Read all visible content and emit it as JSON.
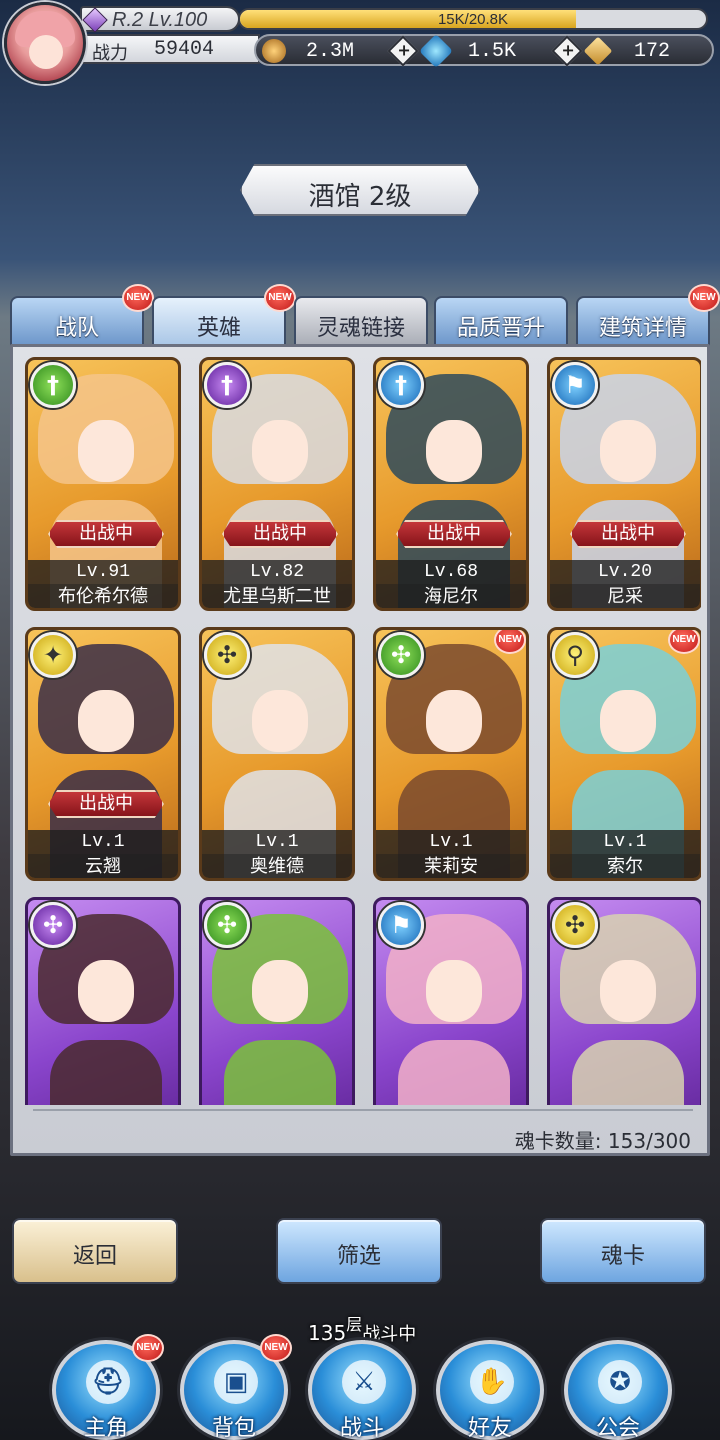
{
  "player": {
    "rank": "R.2 Lv.100",
    "exp_text": "15K/20.8K",
    "exp_fraction": 0.72,
    "power_label": "战力",
    "power_value": "59404"
  },
  "currency": [
    {
      "name": "gold",
      "value": "2.3M",
      "color": "#d9a03a"
    },
    {
      "name": "gem",
      "value": "1.5K",
      "color": "#3aa8e0"
    },
    {
      "name": "crystal",
      "value": "172",
      "color": "#e0b060"
    }
  ],
  "banner": {
    "title": "酒馆 2级"
  },
  "tabs": [
    {
      "label": "战队",
      "badge": "NEW"
    },
    {
      "label": "英雄",
      "badge": "NEW"
    },
    {
      "label": "灵魂链接",
      "badge": ""
    },
    {
      "label": "品质晋升",
      "badge": ""
    },
    {
      "label": "建筑详情",
      "badge": "NEW"
    }
  ],
  "heroes": [
    {
      "name": "布伦希尔德",
      "level": "Lv.91",
      "status": "出战中",
      "element": "green",
      "frame": "gold",
      "badge": "",
      "icon": "sword-icon",
      "hair": "#f5c48a"
    },
    {
      "name": "尤里乌斯二世",
      "level": "Lv.82",
      "status": "出战中",
      "element": "purple",
      "frame": "gold",
      "badge": "",
      "icon": "sword-icon",
      "hair": "#d8dbe2"
    },
    {
      "name": "海尼尔",
      "level": "Lv.68",
      "status": "出战中",
      "element": "blue",
      "frame": "gold",
      "badge": "",
      "icon": "sword-icon",
      "hair": "#2e4a5c"
    },
    {
      "name": "尼采",
      "level": "Lv.20",
      "status": "出战中",
      "element": "blue",
      "frame": "gold",
      "badge": "",
      "icon": "flag-icon",
      "hair": "#c8d4ea"
    },
    {
      "name": "云翘",
      "level": "Lv.1",
      "status": "出战中",
      "element": "yellow",
      "frame": "gold",
      "badge": "",
      "icon": "wings-icon",
      "hair": "#3a2e48"
    },
    {
      "name": "奥维德",
      "level": "Lv.1",
      "status": "",
      "element": "yellow",
      "frame": "gold",
      "badge": "",
      "icon": "shuriken-icon",
      "hair": "#dfe2e8"
    },
    {
      "name": "茉莉安",
      "level": "Lv.1",
      "status": "",
      "element": "green",
      "frame": "gold",
      "badge": "NEW",
      "icon": "shuriken-icon",
      "hair": "#7a4a2e"
    },
    {
      "name": "索尔",
      "level": "Lv.1",
      "status": "",
      "element": "yellow",
      "frame": "gold",
      "badge": "NEW",
      "icon": "magnifier-icon",
      "hair": "#7ad0d8"
    },
    {
      "name": "",
      "level": "",
      "status": "",
      "element": "purple",
      "frame": "purple",
      "badge": "",
      "icon": "shuriken-icon",
      "hair": "#4a2a2e"
    },
    {
      "name": "",
      "level": "",
      "status": "",
      "element": "green",
      "frame": "purple",
      "badge": "",
      "icon": "shuriken-icon",
      "hair": "#7ac23a"
    },
    {
      "name": "",
      "level": "",
      "status": "",
      "element": "blue",
      "frame": "purple",
      "badge": "",
      "icon": "flag-icon",
      "hair": "#f2b0c8"
    },
    {
      "name": "",
      "level": "",
      "status": "",
      "element": "yellow",
      "frame": "purple",
      "badge": "",
      "icon": "shuriken-icon",
      "hair": "#d8d2b0"
    }
  ],
  "soul_count": "魂卡数量: 153/300",
  "buttons": {
    "back": "返回",
    "filter": "筛选",
    "soul": "魂卡"
  },
  "floor": {
    "number": "135",
    "unit": "层",
    "status": "战斗中"
  },
  "nav": [
    {
      "label": "主角",
      "badge": "NEW",
      "icon": "helmet-icon"
    },
    {
      "label": "背包",
      "badge": "NEW",
      "icon": "backpack-icon"
    },
    {
      "label": "战斗",
      "badge": "",
      "icon": "crossed-swords-icon"
    },
    {
      "label": "好友",
      "badge": "",
      "icon": "handshake-icon"
    },
    {
      "label": "公会",
      "badge": "",
      "icon": "guild-crest-icon"
    }
  ]
}
